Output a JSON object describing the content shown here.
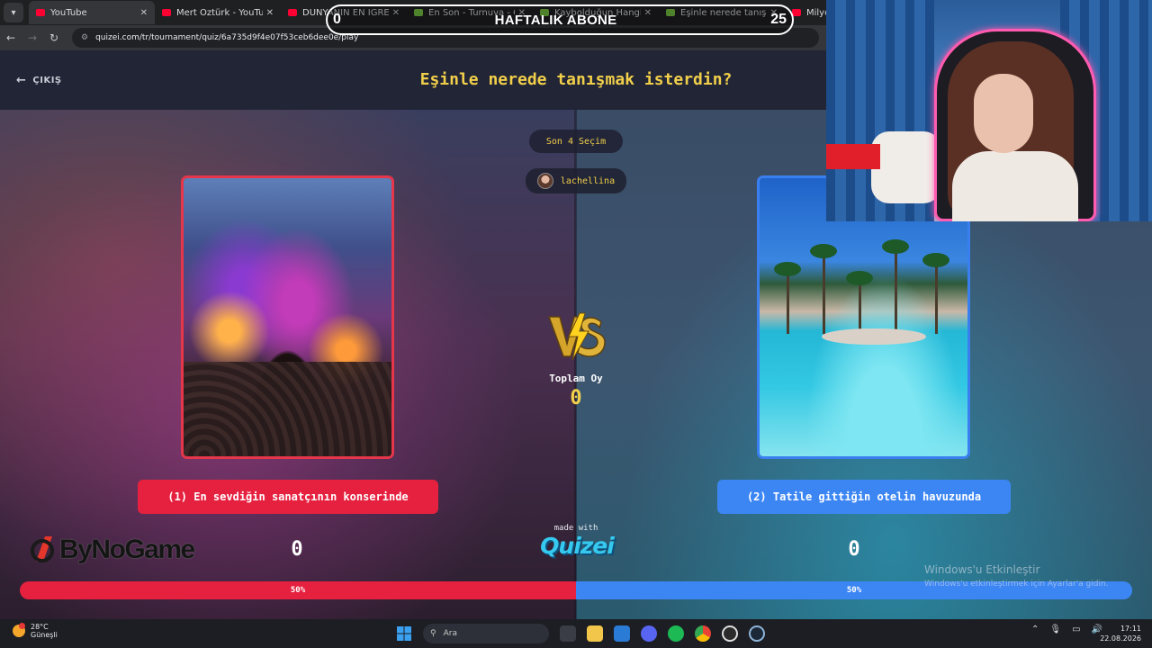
{
  "browser": {
    "tabs": [
      {
        "title": "YouTube",
        "icon": "youtube-icon",
        "color": "#ff0033"
      },
      {
        "title": "Mert Öztürk - YouTube",
        "icon": "youtube-icon",
        "color": "#ff0033"
      },
      {
        "title": "DÜNYANIN EN İĞRENÇ S",
        "icon": "youtube-icon",
        "color": "#ff0033"
      },
      {
        "title": "En Son - Turnuva - Quizei",
        "icon": "quizei-icon",
        "color": "#7ac943"
      },
      {
        "title": "Kaybolduğun Hangi Yolda",
        "icon": "quizei-icon",
        "color": "#7ac943"
      },
      {
        "title": "Eşinle nerede tanışmak is",
        "icon": "quizei-icon",
        "color": "#7ac943"
      },
      {
        "title": "Milyon D",
        "icon": "youtube-icon",
        "color": "#ff0033"
      }
    ],
    "url": "quizei.com/tr/tournament/quiz/6a735d9f4e07f53ceb6dee0e/play"
  },
  "subscriber_goal": {
    "current": "0",
    "label": "HAFTALIK ABONE",
    "target": "25"
  },
  "app": {
    "exit_label": "ÇIKIŞ",
    "question": "Eşinle nerede tanışmak isterdin?",
    "last_choices_label": "Son 4 Seçim",
    "username": "lachellina",
    "total_votes_label": "Toplam Oy",
    "total_votes": "0",
    "made_with": "made with",
    "brand": "Quizei",
    "sponsor": "ByNoGame",
    "left_option": {
      "label": "(1) En sevdiğin sanatçının konserinde",
      "votes": "0",
      "percent": 50,
      "percent_label": "50%",
      "color": "#e5213f"
    },
    "right_option": {
      "label": "(2) Tatile gittiğin otelin havuzunda",
      "votes": "0",
      "percent": 50,
      "percent_label": "50%",
      "color": "#3c86f4"
    }
  },
  "windows": {
    "activation_title": "Windows'u Etkinleştir",
    "activation_sub": "Windows'u etkinleştirmek için Ayarlar'a gidin.",
    "weather_temp": "28°C",
    "weather_desc": "Güneşli",
    "search_placeholder": "Ara",
    "time": "17:11",
    "date": "22.08.2026"
  }
}
